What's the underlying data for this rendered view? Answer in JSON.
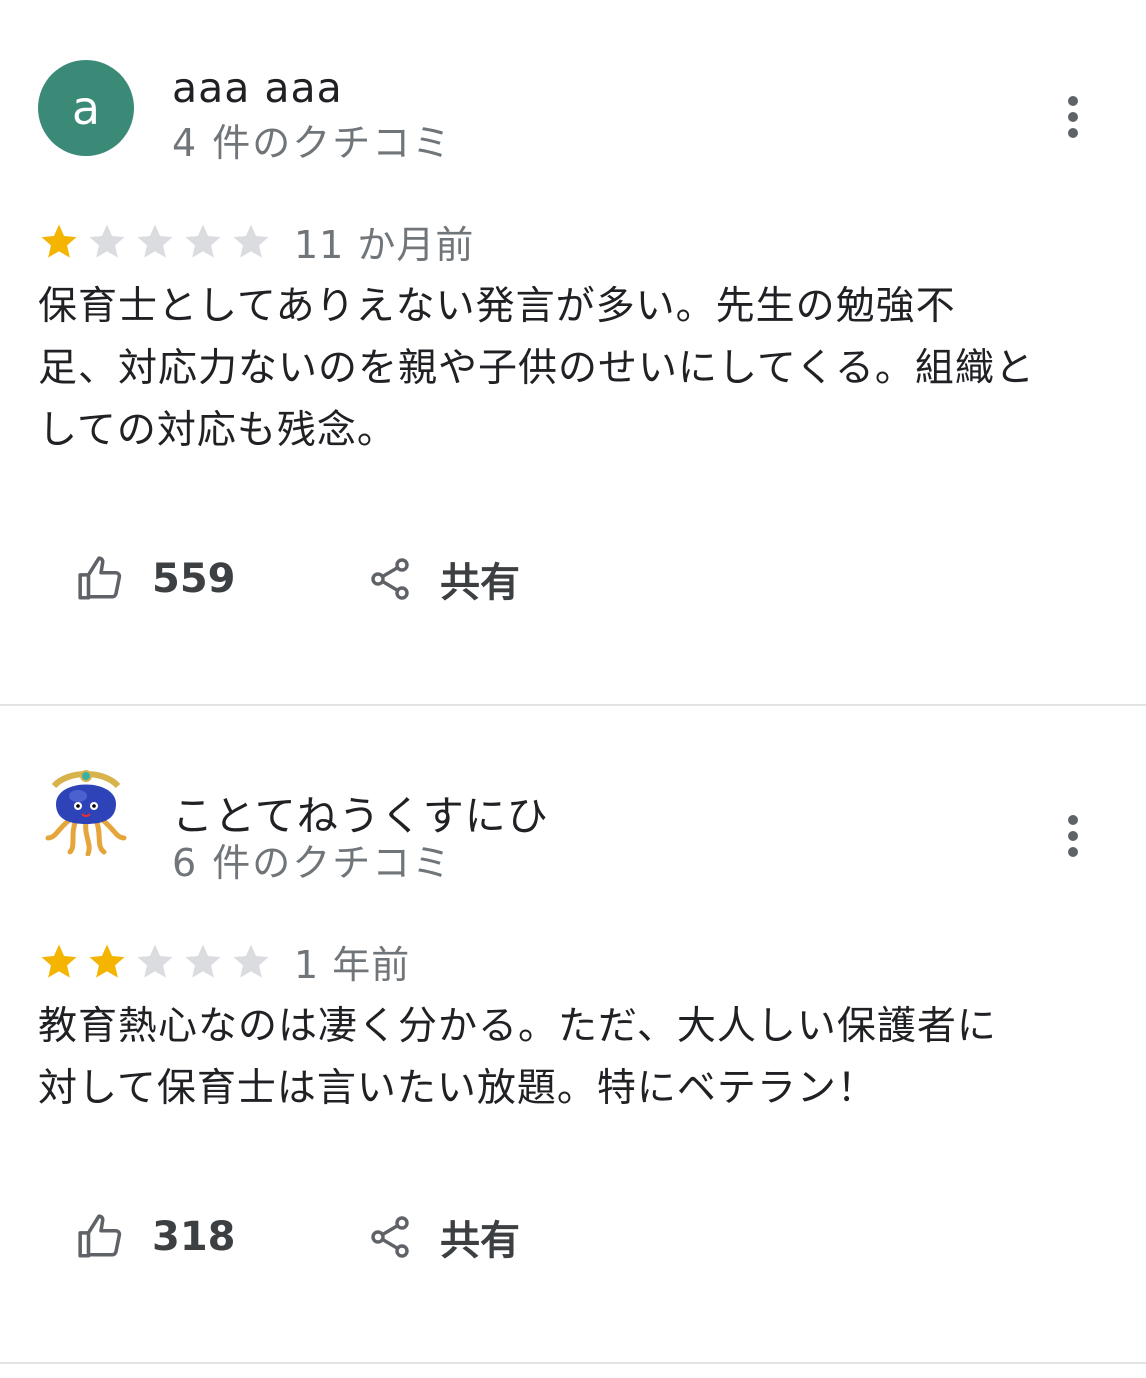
{
  "colors": {
    "star_filled": "#f4b400",
    "star_empty": "#dadce0",
    "avatar_bg": "#3b8a78",
    "secondary_text": "#70757a"
  },
  "reviews": [
    {
      "avatar_letter": "a",
      "author": "aaa aaa",
      "review_count": "4 件のクチコミ",
      "rating": 1,
      "rating_max": 5,
      "time_ago": "11 か月前",
      "text_lines": [
        "保育士としてありえない発言が多い。先生の勉強不",
        "足、対応力ないのを親や子供のせいにしてくる。組織と",
        "しての対応も残念。"
      ],
      "likes": "559",
      "share_label": "共有",
      "like_icon": "thumbs-up-icon",
      "share_icon": "share-icon",
      "more_icon": "more-vert-icon"
    },
    {
      "avatar_letter": "",
      "author": "ことてねうくすにひ",
      "review_count": "6 件のクチコミ",
      "rating": 2,
      "rating_max": 5,
      "time_ago": "1 年前",
      "text_lines": [
        "教育熱心なのは凄く分かる。ただ、大人しい保護者に",
        "対して保育士は言いたい放題。特にベテラン！"
      ],
      "likes": "318",
      "share_label": "共有",
      "like_icon": "thumbs-up-icon",
      "share_icon": "share-icon",
      "more_icon": "more-vert-icon"
    }
  ]
}
